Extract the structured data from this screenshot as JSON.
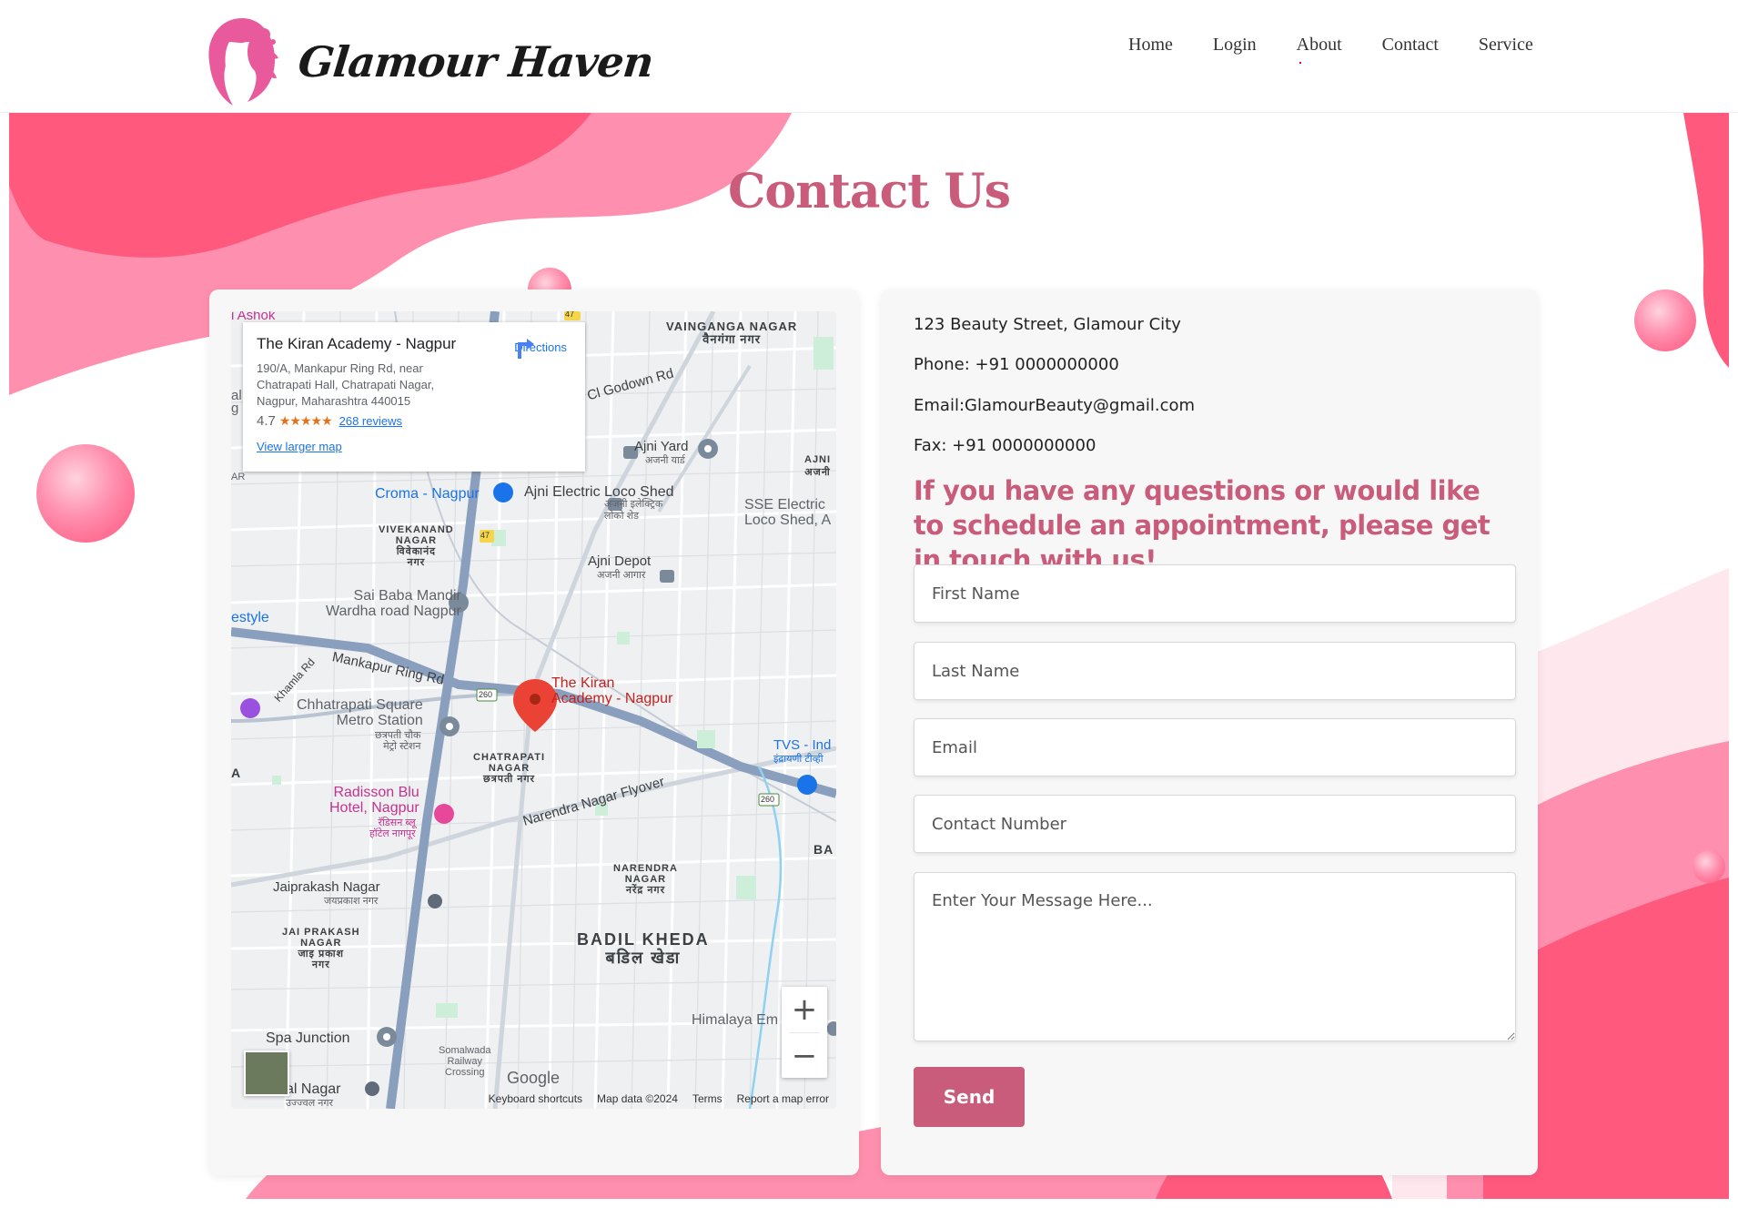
{
  "header": {
    "brand": "Glamour Haven",
    "nav": [
      "Home",
      "Login",
      "About",
      "Contact",
      "Service"
    ]
  },
  "page": {
    "title": "Contact Us"
  },
  "map": {
    "place_name": "The Kiran Academy - Nagpur",
    "address": "190/A, Mankapur Ring Rd, near Chatrapati Hall, Chatrapati Nagar, Nagpur, Maharashtra 440015",
    "rating": "4.7",
    "stars": "★★★★★",
    "reviews": "268 reviews",
    "view_larger": "View larger map",
    "directions": "Directions",
    "pin_label_1": "The Kiran",
    "pin_label_2": "Academy - Nagpur",
    "labels": {
      "vaingana": "VAINGANGA NAGAR",
      "vaingana_hi": "वैनगंगा नगर",
      "godown": "Cl Godown Rd",
      "ajni_yard": "Ajni Yard",
      "ajni_yard_hi": "अजनी यार्ड",
      "ajni": "AJNI",
      "ajni_hi": "अजनी",
      "croma": "Croma - Nagpur",
      "loco": "Ajni Electric Loco Shed",
      "loco_hi_1": "अजनी इलेक्ट्रिक",
      "loco_hi_2": "लोको शेड",
      "sse_1": "SSE Electric",
      "sse_2": "Loco Shed, A",
      "vivekanand_1": "VIVEKANAND",
      "vivekanand_2": "NAGAR",
      "vivekanand_hi_1": "विवेकानंद",
      "vivekanand_hi_2": "नगर",
      "ajni_depot": "Ajni Depot",
      "ajni_depot_hi": "अजनी आगार",
      "sai_1": "Sai Baba Mandir",
      "sai_2": "Wardha road Nagpur",
      "lifestyle": "estyle",
      "mankapur": "Mankapur Ring Rd",
      "khamla": "Khamla Rd",
      "chhatrapati_1": "Chhatrapati Square",
      "chhatrapati_2": "Metro Station",
      "chhatrapati_hi_1": "छत्रपती चौक",
      "chhatrapati_hi_2": "मेट्रो स्टेशन",
      "chatrapati_n_1": "CHATRAPATI",
      "chatrapati_n_2": "NAGAR",
      "chatrapati_n_hi": "छत्रपती नगर",
      "tvs_1": "TVS - Ind",
      "tvs_2": "इंद्रायणी टीव्ही",
      "radisson_1": "Radisson Blu",
      "radisson_2": "Hotel, Nagpur",
      "radisson_hi_1": "रॅडिसन ब्लू",
      "radisson_hi_2": "हॉटेल नागपूर",
      "flyover": "Narendra Nagar Flyover",
      "ba": "BA",
      "jaiprakash": "Jaiprakash Nagar",
      "jaiprakash_hi": "जयप्रकाश नगर",
      "narendra_1": "NARENDRA",
      "narendra_2": "NAGAR",
      "narendra_hi": "नरेंद्र नगर",
      "jai_1": "JAI PRAKASH",
      "jai_2": "NAGAR",
      "jai_hi_1": "जाइ प्रकाश",
      "jai_hi_2": "नगर",
      "badil": "BADIL KHEDA",
      "badil_hi": "बडिल खेडा",
      "himalaya": "Himalaya Em",
      "spa": "Spa Junction",
      "somalwada_1": "Somalwada",
      "somalwada_2": "Railway",
      "somalwada_3": "Crossing",
      "ujjwal": "al Nagar",
      "ujjwal_hi": "उज्ज्वल नगर",
      "ashok": "l Ashok",
      "al": "al",
      "g": "g",
      "ar": "AR",
      "a": "A",
      "r47": "47",
      "r260": "260"
    },
    "attribution": {
      "shortcuts": "Keyboard shortcuts",
      "data": "Map data ©2024",
      "terms": "Terms",
      "report": "Report a map error"
    },
    "google": "Google"
  },
  "contact": {
    "address": "123 Beauty Street, Glamour City",
    "phone": "Phone: +91 0000000000",
    "email": "Email:GlamourBeauty@gmail.com",
    "fax": "Fax: +91 0000000000",
    "cta": "If you have any questions or would like to schedule an appointment, please get in touch with us!"
  },
  "form": {
    "first_name_placeholder": "First Name",
    "last_name_placeholder": "Last Name",
    "email_placeholder": "Email",
    "contact_placeholder": "Contact Number",
    "message_placeholder": "Enter Your Message Here...",
    "send_label": "Send"
  },
  "colors": {
    "accent": "#c95c7b",
    "pink_dark": "#ff5a7e",
    "pink_light": "#ff8fae"
  }
}
